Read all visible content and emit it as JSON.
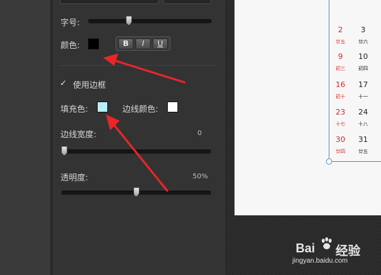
{
  "panel": {
    "font_size_label": "字号:",
    "color_label": "颜色:",
    "text_color": "#000000",
    "format_buttons": {
      "bold": "B",
      "italic": "I",
      "underline": "U"
    },
    "use_border_label": "使用边框",
    "use_border_checked": true,
    "fill_color_label": "填充色:",
    "fill_color": "#b8eef5",
    "border_color_label": "边线颜色:",
    "border_color": "#ffffff",
    "border_width_label": "边线宽度:",
    "border_width_value": "0",
    "opacity_label": "透明度:",
    "opacity_value": "50%",
    "font_size_slider_fraction": 0.32,
    "border_width_slider_fraction": 0.0,
    "opacity_slider_fraction": 0.5
  },
  "calendar": {
    "row1": {
      "d1": "2",
      "l1": "廿五",
      "d2": "3",
      "l2": "廿六"
    },
    "row2": {
      "d1": "9",
      "l1": "初三",
      "d2": "10",
      "l2": "初四"
    },
    "row3": {
      "d1": "16",
      "l1": "初十",
      "d2": "17",
      "l2": "十一"
    },
    "row4": {
      "d1": "23",
      "l1": "十七",
      "d2": "24",
      "l2": "十八"
    },
    "row5": {
      "d1": "30",
      "l1": "廿四",
      "d2": "31",
      "l2": "廿五"
    },
    "frame_color": "#5b8fc9"
  },
  "annotation_color": "#e8262a",
  "watermark": {
    "logo": "Bai",
    "logo_suffix": "经验",
    "url": "jingyan.baidu.com"
  }
}
